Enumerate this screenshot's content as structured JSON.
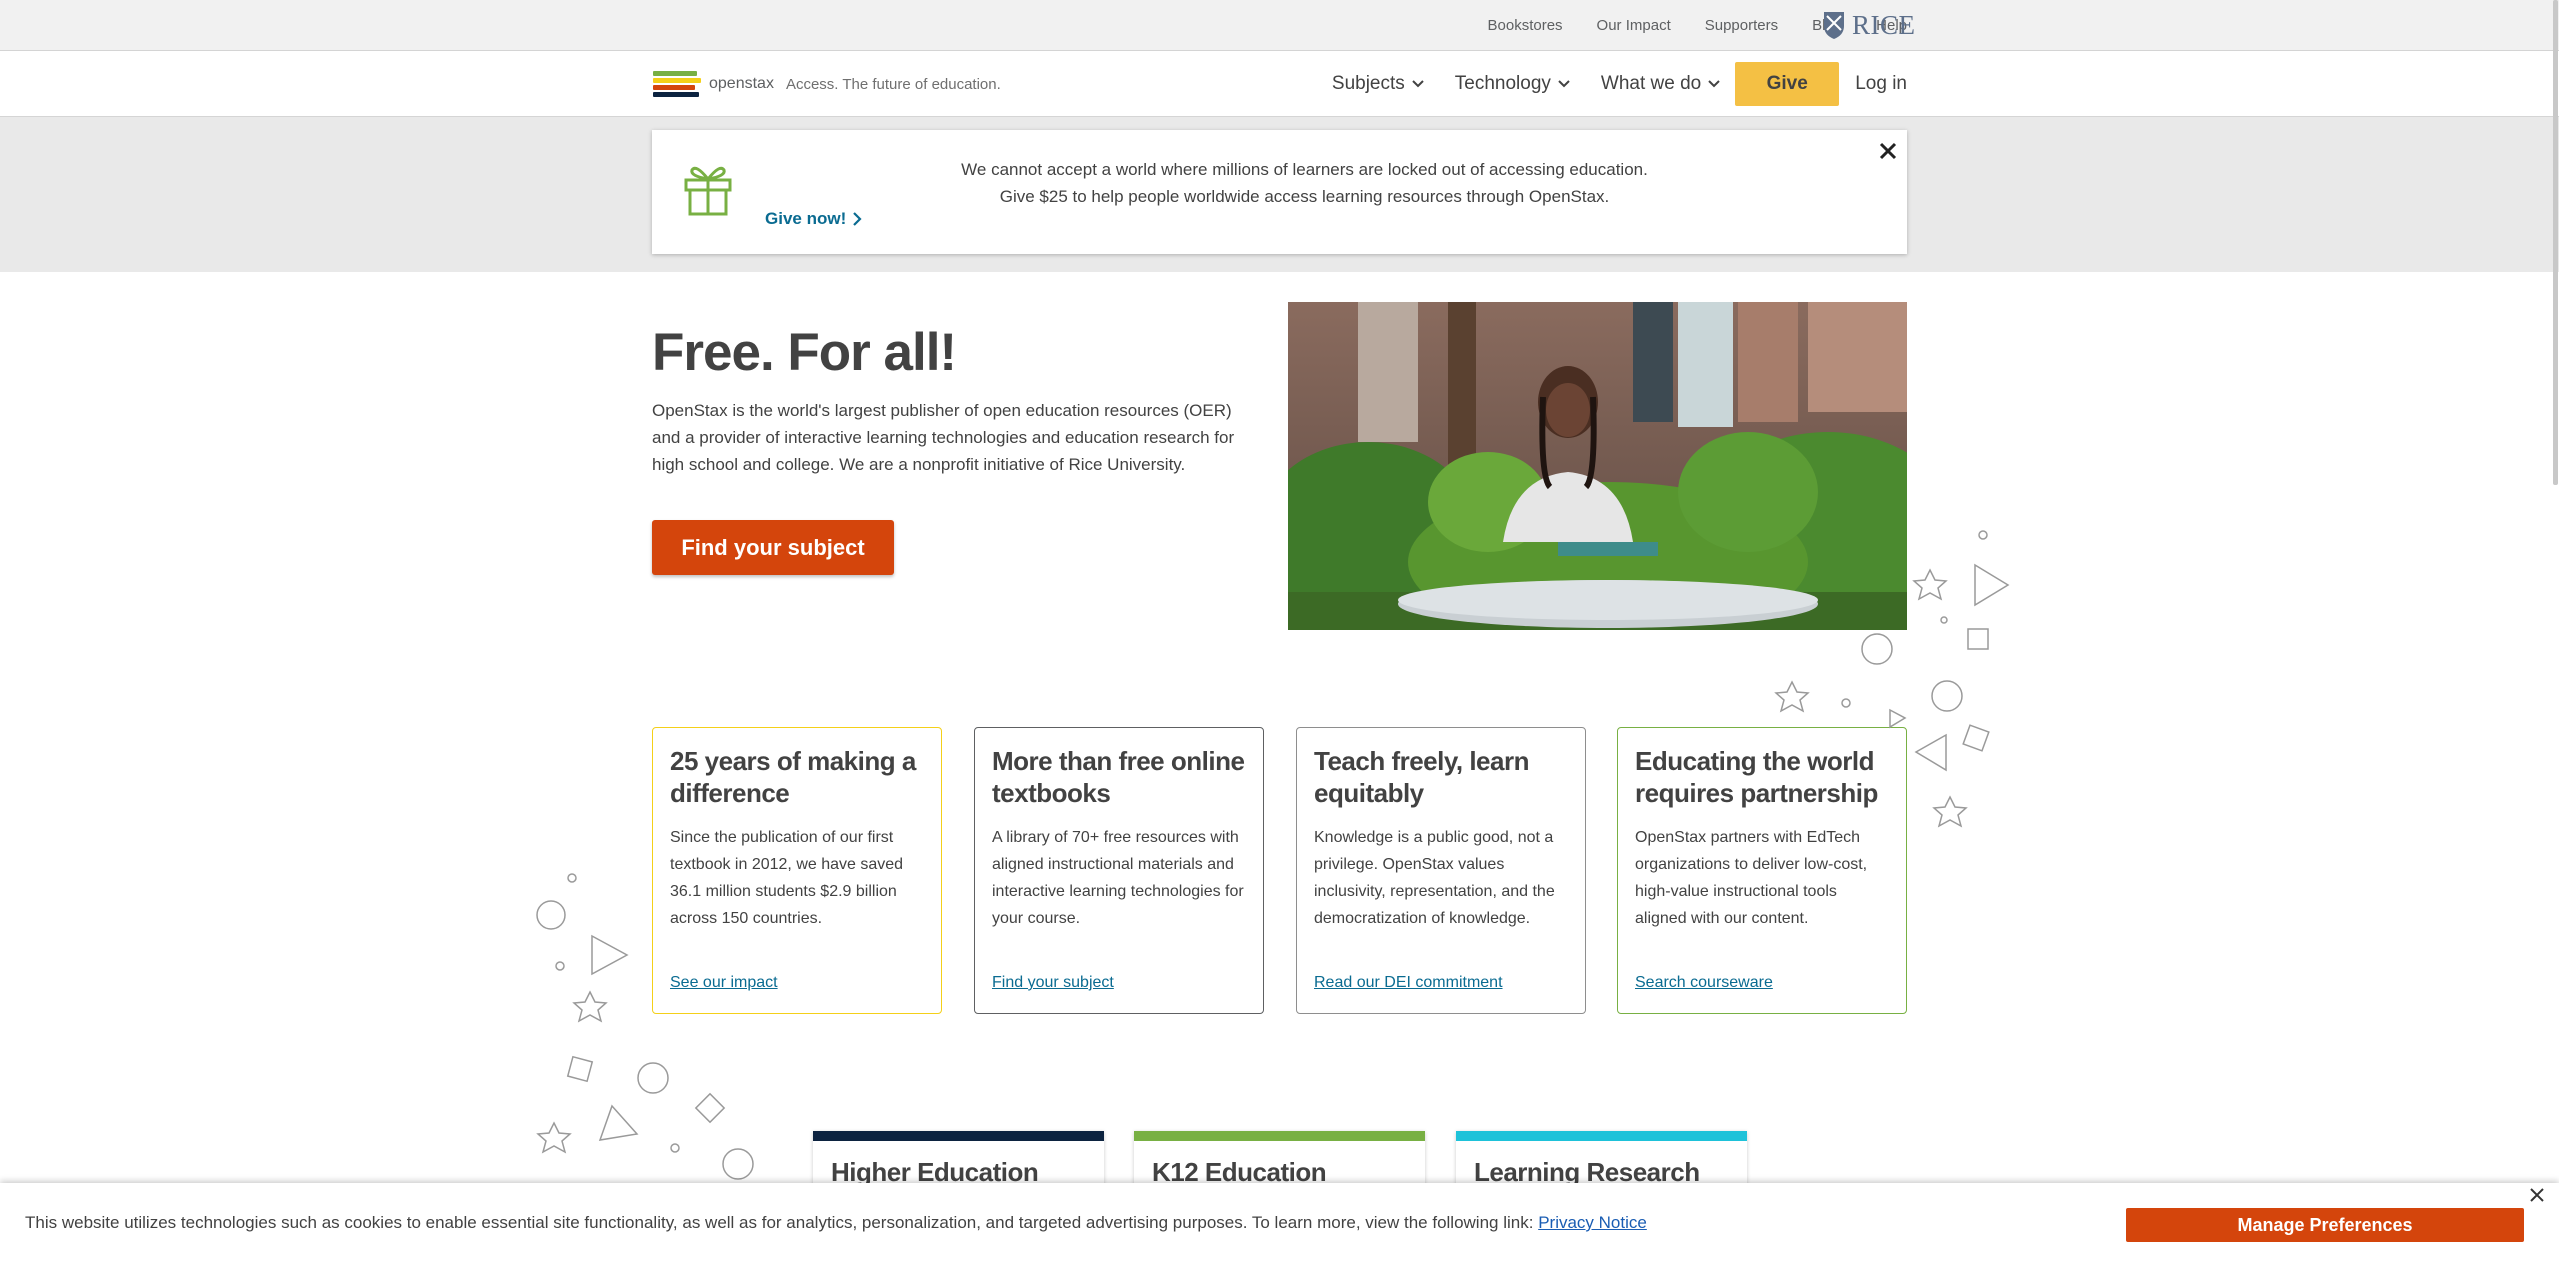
{
  "utility": {
    "links": [
      "Bookstores",
      "Our Impact",
      "Supporters",
      "Blog",
      "Help"
    ],
    "rice_logo": "RICE"
  },
  "nav": {
    "brand_name": "openstax",
    "tagline": "Access. The future of education.",
    "items": [
      {
        "label": "Subjects",
        "icon": "chevron-down-icon"
      },
      {
        "label": "Technology",
        "icon": "chevron-down-icon"
      },
      {
        "label": "What we do",
        "icon": "chevron-down-icon"
      }
    ],
    "give_label": "Give",
    "login_label": "Log in"
  },
  "banner": {
    "message_line1": "We cannot accept a world where millions of learners are locked out of accessing education.",
    "message_line2": "Give $25 to help people worldwide access learning resources through OpenStax.",
    "give_now": "Give now!",
    "icon": "gift-icon",
    "close_icon": "close-icon"
  },
  "hero": {
    "title": "Free. For all!",
    "description": "OpenStax is the world's largest publisher of open education resources (OER) and a provider of interactive learning technologies and education research for high school and college. We are a nonprofit initiative of Rice University.",
    "cta_label": "Find your subject"
  },
  "cards": [
    {
      "title": "25 years of making a difference",
      "body": "Since the publication of our first textbook in 2012, we have saved 36.1 million students $2.9 billion across 150 countries.",
      "link": "See our impact",
      "border_color": "#f4d019"
    },
    {
      "title": "More than free online textbooks",
      "body": "A library of 70+ free resources with aligned instructional materials and interactive learning technologies for your course.",
      "link": "Find your subject",
      "border_color": "#5e6062"
    },
    {
      "title": "Teach freely, learn equitably",
      "body": "Knowledge is a public good, not a privilege. OpenStax values inclusivity, representation, and the democratization of knowledge.",
      "link": "Read our DEI commitment",
      "border_color": "#8e8e8e"
    },
    {
      "title": "Educating the world requires partnership",
      "body": "OpenStax partners with EdTech organizations to deliver low-cost, high-value instructional tools aligned with our content.",
      "link": "Search courseware",
      "border_color": "#78b043"
    }
  ],
  "tiles": [
    {
      "title": "Higher Education",
      "color": "#0c2340"
    },
    {
      "title": "K12 Education",
      "color": "#78b043"
    },
    {
      "title": "Learning Research",
      "color": "#1ec2d9"
    }
  ],
  "cookie": {
    "text": "This website utilizes technologies such as cookies to enable essential site functionality, as well as for analytics, personalization, and targeted advertising purposes. To learn more, view the following link:",
    "link": "Privacy Notice",
    "button": "Manage Preferences"
  },
  "colors": {
    "accent_orange": "#d4450c",
    "give_yellow": "#f4c044",
    "link_blue": "#0a6b91"
  }
}
